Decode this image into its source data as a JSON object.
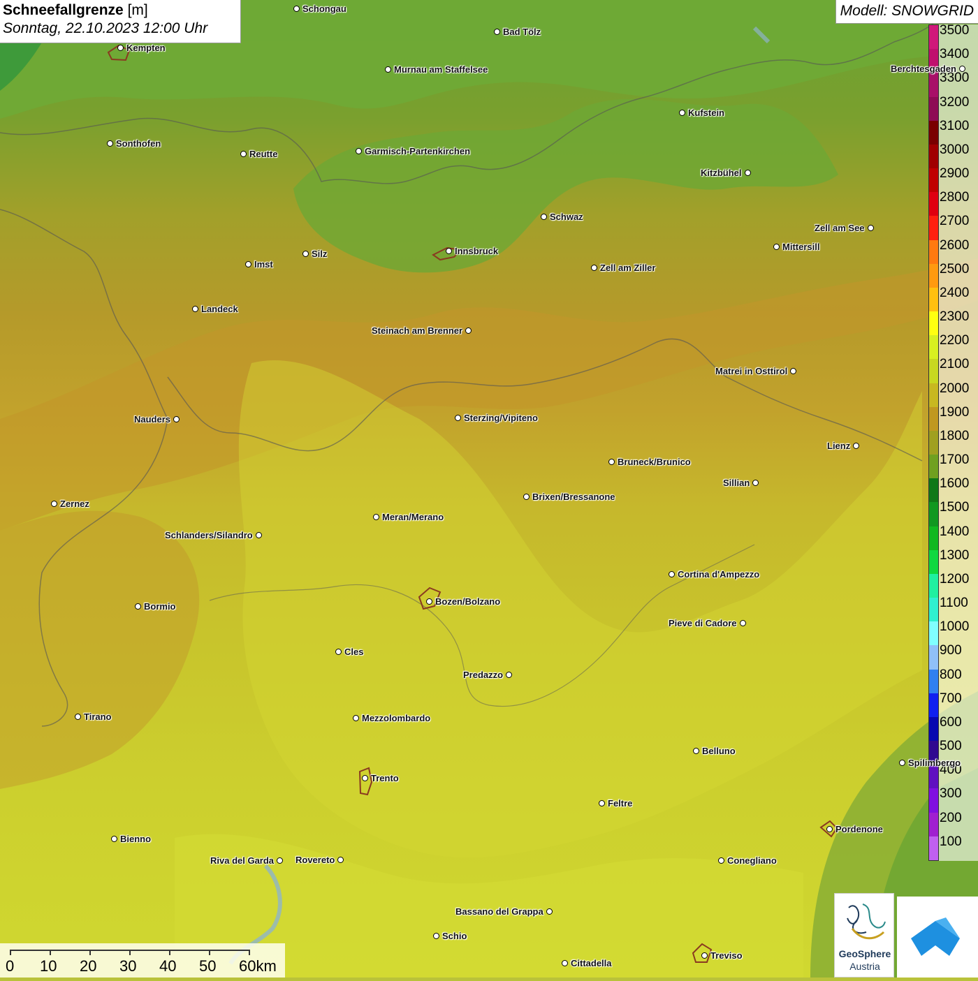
{
  "title": {
    "parameter": "Schneefallgrenze",
    "unit": "[m]",
    "datetime": "Sonntag, 22.10.2023 12:00 Uhr"
  },
  "model": "Modell: SNOWGRID",
  "legend": {
    "levels": [
      {
        "value": "3500",
        "color": "#d0187a"
      },
      {
        "value": "3400",
        "color": "#c0106e"
      },
      {
        "value": "3300",
        "color": "#a81068"
      },
      {
        "value": "3200",
        "color": "#8e0c55"
      },
      {
        "value": "3100",
        "color": "#7a0000"
      },
      {
        "value": "3000",
        "color": "#a00000"
      },
      {
        "value": "2900",
        "color": "#c00000"
      },
      {
        "value": "2800",
        "color": "#e00010"
      },
      {
        "value": "2700",
        "color": "#ff2010"
      },
      {
        "value": "2600",
        "color": "#ff7a10"
      },
      {
        "value": "2500",
        "color": "#ff9a10"
      },
      {
        "value": "2400",
        "color": "#ffc010"
      },
      {
        "value": "2300",
        "color": "#ffff10"
      },
      {
        "value": "2200",
        "color": "#d8f020"
      },
      {
        "value": "2100",
        "color": "#c8d820"
      },
      {
        "value": "2000",
        "color": "#c8b820"
      },
      {
        "value": "1900",
        "color": "#c09820"
      },
      {
        "value": "1800",
        "color": "#a0a020"
      },
      {
        "value": "1700",
        "color": "#70a020"
      },
      {
        "value": "1600",
        "color": "#107818"
      },
      {
        "value": "1500",
        "color": "#109820"
      },
      {
        "value": "1400",
        "color": "#10b820"
      },
      {
        "value": "1300",
        "color": "#10d840"
      },
      {
        "value": "1200",
        "color": "#20f0a0"
      },
      {
        "value": "1100",
        "color": "#30f0d0"
      },
      {
        "value": "1000",
        "color": "#80ffff"
      },
      {
        "value": "900",
        "color": "#90c0f8"
      },
      {
        "value": "800",
        "color": "#3080f0"
      },
      {
        "value": "700",
        "color": "#1020f0"
      },
      {
        "value": "600",
        "color": "#0808b0"
      },
      {
        "value": "500",
        "color": "#300890"
      },
      {
        "value": "400",
        "color": "#6010c0"
      },
      {
        "value": "300",
        "color": "#8010e0"
      },
      {
        "value": "200",
        "color": "#a020d0"
      },
      {
        "value": "100",
        "color": "#c060f0"
      }
    ]
  },
  "cities": [
    {
      "name": "Schongau"
    },
    {
      "name": "Bad Tölz"
    },
    {
      "name": "Kempten"
    },
    {
      "name": "Murnau am Staffelsee"
    },
    {
      "name": "Berchtesgaden"
    },
    {
      "name": "Kufstein"
    },
    {
      "name": "Sonthofen"
    },
    {
      "name": "Reutte"
    },
    {
      "name": "Garmisch-Partenkirchen"
    },
    {
      "name": "Kitzbühel"
    },
    {
      "name": "Schwaz"
    },
    {
      "name": "Zell am See"
    },
    {
      "name": "Innsbruck"
    },
    {
      "name": "Mittersill"
    },
    {
      "name": "Imst"
    },
    {
      "name": "Silz"
    },
    {
      "name": "Zell am Ziller"
    },
    {
      "name": "Landeck"
    },
    {
      "name": "Steinach am Brenner"
    },
    {
      "name": "Matrei in Osttirol"
    },
    {
      "name": "Nauders"
    },
    {
      "name": "Sterzing/Vipiteno"
    },
    {
      "name": "Lienz"
    },
    {
      "name": "Bruneck/Brunico"
    },
    {
      "name": "Sillian"
    },
    {
      "name": "Zernez"
    },
    {
      "name": "Brixen/Bressanone"
    },
    {
      "name": "Meran/Merano"
    },
    {
      "name": "Schlanders/Silandro"
    },
    {
      "name": "Cortina d'Ampezzo"
    },
    {
      "name": "Bormio"
    },
    {
      "name": "Bozen/Bolzano"
    },
    {
      "name": "Pieve di Cadore"
    },
    {
      "name": "Cles"
    },
    {
      "name": "Predazzo"
    },
    {
      "name": "Tirano"
    },
    {
      "name": "Mezzolombardo"
    },
    {
      "name": "Belluno"
    },
    {
      "name": "Spilimbergo"
    },
    {
      "name": "Trento"
    },
    {
      "name": "Feltre"
    },
    {
      "name": "Pordenone"
    },
    {
      "name": "Bienno"
    },
    {
      "name": "Riva del Garda"
    },
    {
      "name": "Rovereto"
    },
    {
      "name": "Conegliano"
    },
    {
      "name": "Bassano del Grappa"
    },
    {
      "name": "Schio"
    },
    {
      "name": "Treviso"
    },
    {
      "name": "Cittadella"
    }
  ],
  "scale": {
    "labels": [
      "0",
      "10",
      "20",
      "30",
      "40",
      "50",
      "60km"
    ]
  },
  "logo": {
    "name": "GeoSphere",
    "subname": "Austria"
  }
}
